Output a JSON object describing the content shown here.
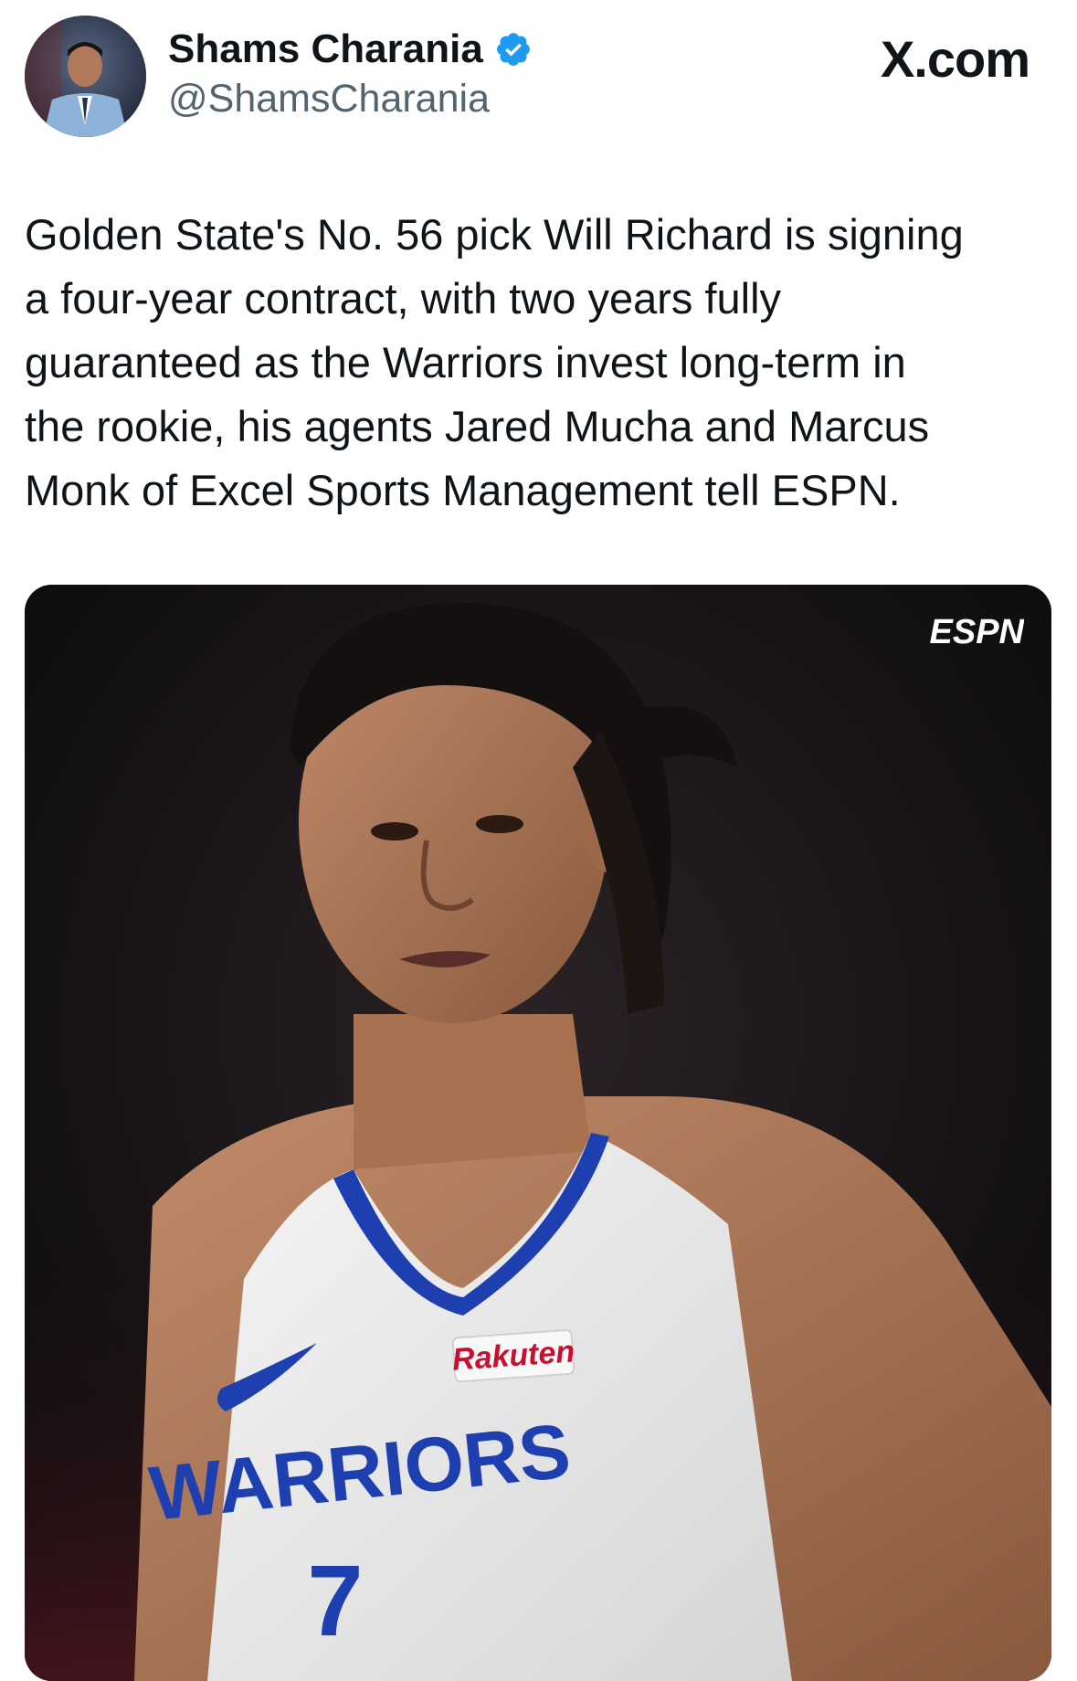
{
  "author": {
    "display_name": "Shams Charania",
    "handle": "@ShamsCharania",
    "verified": true,
    "avatar_icon": "profile-photo"
  },
  "site": {
    "label": "X.com"
  },
  "tweet": {
    "text": "Golden State's No. 56 pick Will Richard is signing\na four-year contract, with two years fully\nguaranteed as the Warriors invest long-term in\nthe rookie, his agents Jared Mucha and Marcus\nMonk of Excel Sports Management tell ESPN."
  },
  "media": {
    "watermark": "ESPN",
    "jersey_sponsor": "Rakuten",
    "jersey_team": "WARRIORS",
    "jersey_number": "7"
  },
  "colors": {
    "text_primary": "#0f1419",
    "text_secondary": "#536471",
    "verified_blue": "#1d9bf0",
    "jersey_blue": "#1d3fb0"
  }
}
